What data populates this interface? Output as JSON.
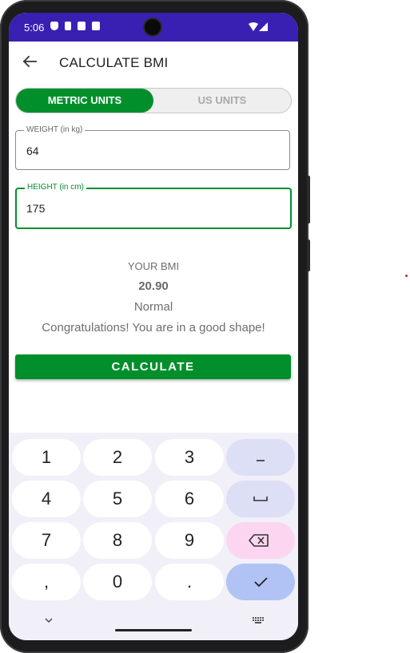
{
  "status_bar": {
    "time": "5:06",
    "background": "#3a1fb3"
  },
  "app_bar": {
    "title": "CALCULATE BMI"
  },
  "units_toggle": {
    "metric_label": "METRIC UNITS",
    "us_label": "US UNITS",
    "selected": "METRIC UNITS",
    "accent": "#018f2c"
  },
  "form": {
    "weight": {
      "label": "WEIGHT (in kg)",
      "value": "64"
    },
    "height": {
      "label": "HEIGHT (in cm)",
      "value": "175"
    }
  },
  "result": {
    "heading": "YOUR BMI",
    "value": "20.90",
    "description": "Normal",
    "message": "Congratulations! You are in a good shape!"
  },
  "calculate_label": "CALCULATE",
  "keyboard": {
    "keys": [
      "1",
      "2",
      "3",
      "4",
      "5",
      "6",
      "7",
      "8",
      "9",
      ",",
      "0",
      "."
    ],
    "icons": [
      "minus-icon",
      "space-icon",
      "backspace-icon",
      "check-icon",
      "chevron-down-icon",
      "keyboard-icon"
    ]
  }
}
